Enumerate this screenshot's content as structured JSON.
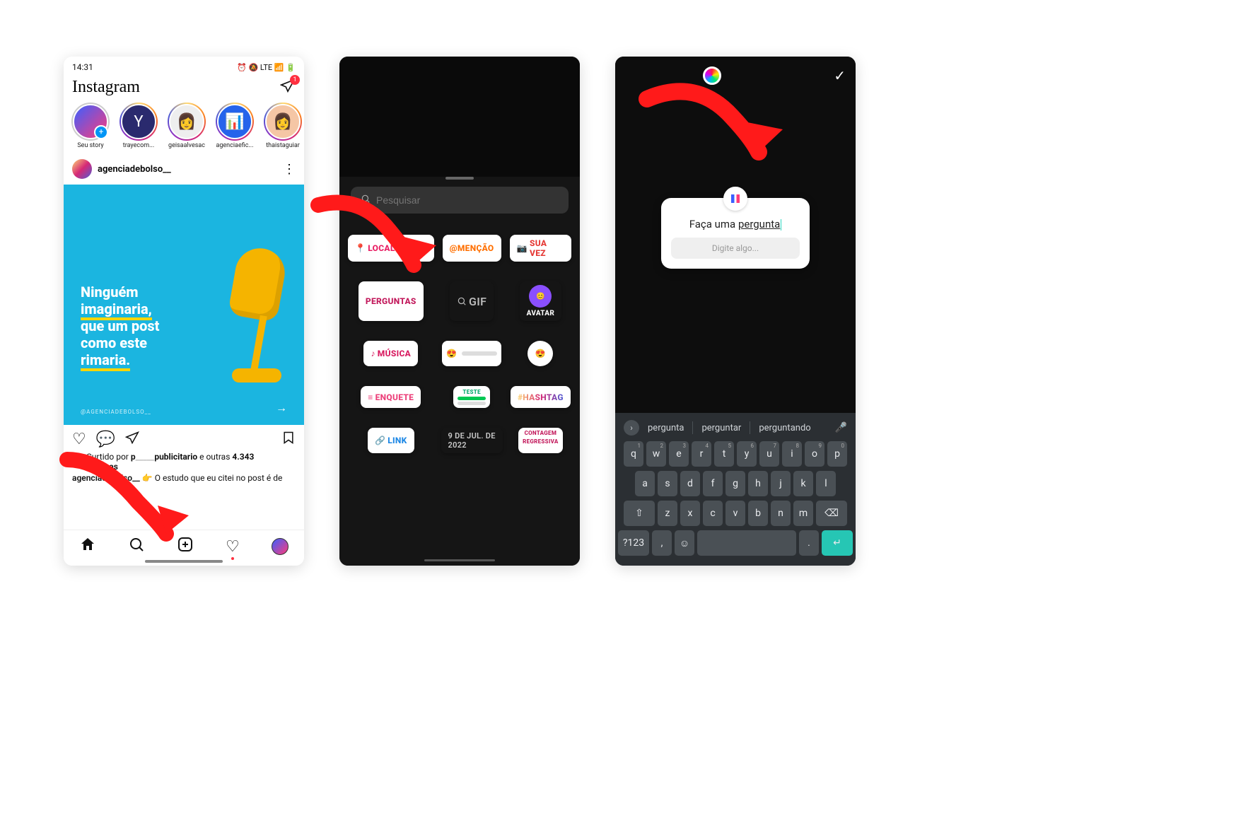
{
  "phone1": {
    "status": {
      "time": "14:31",
      "indicators": "⏰ 🔕 LTE 📶 🔋"
    },
    "app_name": "Instagram",
    "dm_badge": "1",
    "stories": [
      {
        "label": "Seu story"
      },
      {
        "label": "trayecom..."
      },
      {
        "label": "geisaalvesac"
      },
      {
        "label": "agenciaefic..."
      },
      {
        "label": "thaistaguiar"
      }
    ],
    "post": {
      "username": "agenciadebolso__",
      "more_icon": "⋮",
      "image_text": {
        "line1": "Ninguém",
        "line2": "imaginaria,",
        "line3": "que um post",
        "line4": "como este",
        "line5": "rimaria."
      },
      "handle_tag": "@AGENCIADEBOLSO__",
      "likes_prefix": "Curtido por",
      "likes_middle": "e outras",
      "likes_count": "4.343",
      "likes_suffix": "pessoas",
      "likes_masked_word": "publicitario",
      "caption_user": "agenciadebolso__",
      "caption_emoji": "👉",
      "caption_text": "O estudo que eu citei no post é de"
    }
  },
  "phone2": {
    "search_placeholder": "Pesquisar",
    "stickers": {
      "localizacao": "LOCALIZAÇÃO",
      "mencao": "@MENÇÃO",
      "sua_vez_icon": "📷",
      "sua_vez": "SUA VEZ",
      "perguntas": "PERGUNTAS",
      "gif": "GIF",
      "avatar": "AVATAR",
      "musica_icon": "♪",
      "musica": "MÚSICA",
      "enquete": "ENQUETE",
      "teste": "TESTE",
      "hashtag": "#HASHTAG",
      "link_icon": "🔗",
      "link": "LINK",
      "date": "9 DE JUL. DE 2022",
      "countdown1": "CONTAGEM",
      "countdown2": "REGRESSIVA"
    }
  },
  "phone3": {
    "question_title_pre": "Faça uma ",
    "question_title_ul": "pergunta",
    "question_placeholder": "Digite algo...",
    "suggestions": [
      "pergunta",
      "perguntar",
      "perguntando"
    ],
    "keyboard": {
      "row1": [
        "q",
        "w",
        "e",
        "r",
        "t",
        "y",
        "u",
        "i",
        "o",
        "p"
      ],
      "row1_sup": [
        "1",
        "2",
        "3",
        "4",
        "5",
        "6",
        "7",
        "8",
        "9",
        "0"
      ],
      "row2": [
        "a",
        "s",
        "d",
        "f",
        "g",
        "h",
        "j",
        "k",
        "l"
      ],
      "row3": [
        "⇧",
        "z",
        "x",
        "c",
        "v",
        "b",
        "n",
        "m",
        "⌫"
      ],
      "row4_sym": "?123",
      "row4_comma": ",",
      "row4_emoji": "☺",
      "row4_period": ".",
      "row4_enter": "↵"
    }
  }
}
